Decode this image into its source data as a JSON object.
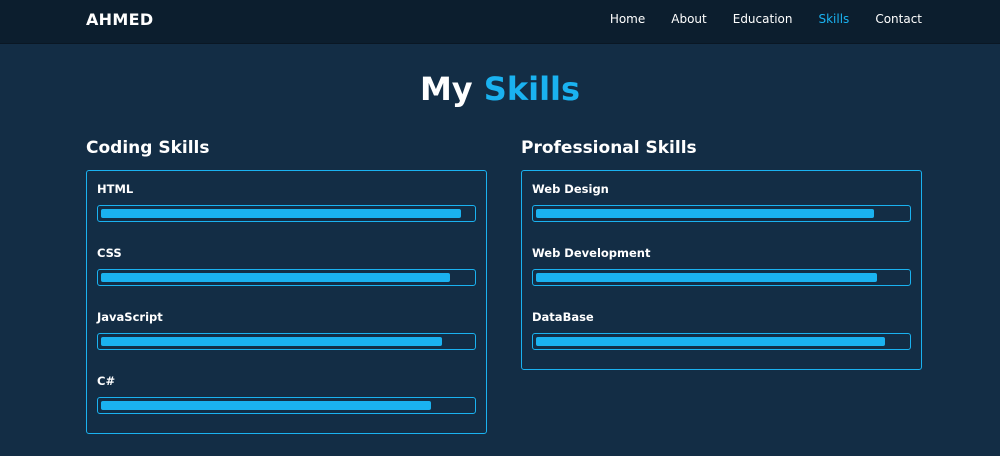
{
  "header": {
    "logo": "AHMED",
    "nav": [
      {
        "label": "Home",
        "active": false
      },
      {
        "label": "About",
        "active": false
      },
      {
        "label": "Education",
        "active": false
      },
      {
        "label": "Skills",
        "active": true
      },
      {
        "label": "Contact",
        "active": false
      }
    ]
  },
  "section": {
    "title_part1": "My",
    "title_part2": "Skills"
  },
  "coding": {
    "title": "Coding Skills",
    "skills": [
      {
        "name": "HTML",
        "percent": 97
      },
      {
        "name": "CSS",
        "percent": 94
      },
      {
        "name": "JavaScript",
        "percent": 92
      },
      {
        "name": "C#",
        "percent": 89
      }
    ]
  },
  "professional": {
    "title": "Professional Skills",
    "skills": [
      {
        "name": "Web Design",
        "percent": 91
      },
      {
        "name": "Web Development",
        "percent": 92
      },
      {
        "name": "DataBase",
        "percent": 94
      }
    ]
  },
  "colors": {
    "accent": "#1ab2f0",
    "background": "#132d45",
    "header": "#0c1e2e"
  }
}
